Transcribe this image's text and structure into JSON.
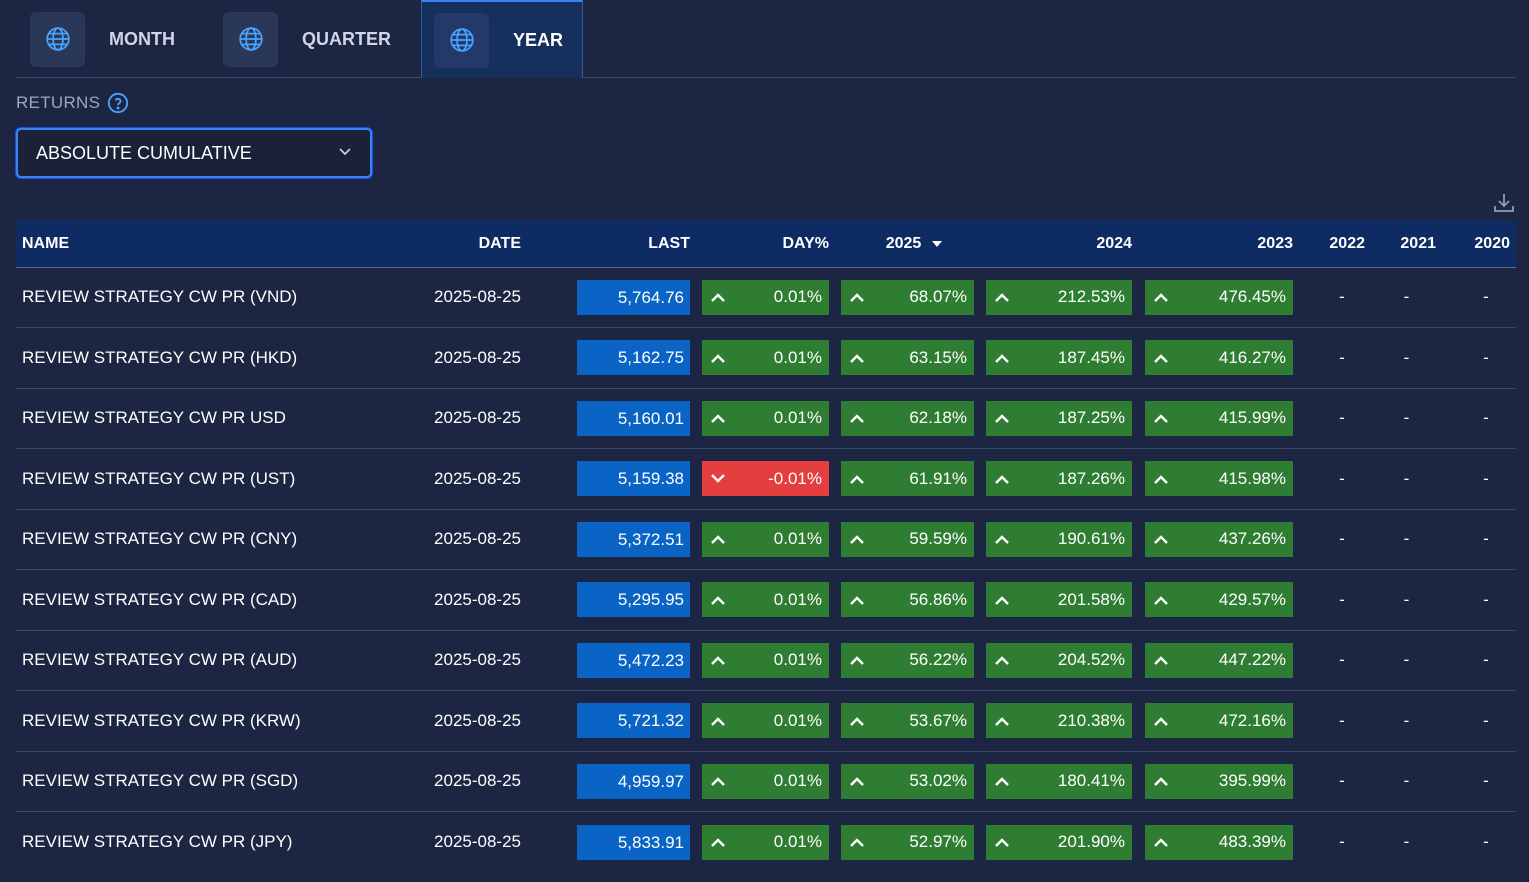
{
  "tabs": [
    {
      "label": "MONTH",
      "active": false,
      "icon": "globe-icon"
    },
    {
      "label": "QUARTER",
      "active": false,
      "icon": "globe-icon"
    },
    {
      "label": "YEAR",
      "active": true,
      "icon": "globe-icon"
    }
  ],
  "returns": {
    "label": "RETURNS",
    "help_icon": "help-circle-icon",
    "select_value": "ABSOLUTE CUMULATIVE"
  },
  "download_icon": "download-icon",
  "colors": {
    "positive": "#2e7d32",
    "negative": "#e53e3e",
    "last": "#0a64c5",
    "header": "#0f2b64",
    "background": "#1c2541"
  },
  "table": {
    "headers": {
      "name": "NAME",
      "date": "DATE",
      "last": "LAST",
      "day": "DAY%",
      "y2025": "2025",
      "y2024": "2024",
      "y2023": "2023",
      "y2022": "2022",
      "y2021": "2021",
      "y2020": "2020"
    },
    "sorted_column": "2025",
    "rows": [
      {
        "name": "REVIEW STRATEGY CW PR (VND)",
        "date": "2025-08-25",
        "last": "5,764.76",
        "day": "0.01%",
        "y2025": "68.07%",
        "y2024": "212.53%",
        "y2023": "476.45%",
        "y2022": "-",
        "y2021": "-",
        "y2020": "-"
      },
      {
        "name": "REVIEW STRATEGY CW PR (HKD)",
        "date": "2025-08-25",
        "last": "5,162.75",
        "day": "0.01%",
        "y2025": "63.15%",
        "y2024": "187.45%",
        "y2023": "416.27%",
        "y2022": "-",
        "y2021": "-",
        "y2020": "-"
      },
      {
        "name": "REVIEW STRATEGY CW PR USD",
        "date": "2025-08-25",
        "last": "5,160.01",
        "day": "0.01%",
        "y2025": "62.18%",
        "y2024": "187.25%",
        "y2023": "415.99%",
        "y2022": "-",
        "y2021": "-",
        "y2020": "-"
      },
      {
        "name": "REVIEW STRATEGY CW PR (UST)",
        "date": "2025-08-25",
        "last": "5,159.38",
        "day": "-0.01%",
        "y2025": "61.91%",
        "y2024": "187.26%",
        "y2023": "415.98%",
        "y2022": "-",
        "y2021": "-",
        "y2020": "-"
      },
      {
        "name": "REVIEW STRATEGY CW PR (CNY)",
        "date": "2025-08-25",
        "last": "5,372.51",
        "day": "0.01%",
        "y2025": "59.59%",
        "y2024": "190.61%",
        "y2023": "437.26%",
        "y2022": "-",
        "y2021": "-",
        "y2020": "-"
      },
      {
        "name": "REVIEW STRATEGY CW PR (CAD)",
        "date": "2025-08-25",
        "last": "5,295.95",
        "day": "0.01%",
        "y2025": "56.86%",
        "y2024": "201.58%",
        "y2023": "429.57%",
        "y2022": "-",
        "y2021": "-",
        "y2020": "-"
      },
      {
        "name": "REVIEW STRATEGY CW PR (AUD)",
        "date": "2025-08-25",
        "last": "5,472.23",
        "day": "0.01%",
        "y2025": "56.22%",
        "y2024": "204.52%",
        "y2023": "447.22%",
        "y2022": "-",
        "y2021": "-",
        "y2020": "-"
      },
      {
        "name": "REVIEW STRATEGY CW PR (KRW)",
        "date": "2025-08-25",
        "last": "5,721.32",
        "day": "0.01%",
        "y2025": "53.67%",
        "y2024": "210.38%",
        "y2023": "472.16%",
        "y2022": "-",
        "y2021": "-",
        "y2020": "-"
      },
      {
        "name": "REVIEW STRATEGY CW PR (SGD)",
        "date": "2025-08-25",
        "last": "4,959.97",
        "day": "0.01%",
        "y2025": "53.02%",
        "y2024": "180.41%",
        "y2023": "395.99%",
        "y2022": "-",
        "y2021": "-",
        "y2020": "-"
      },
      {
        "name": "REVIEW STRATEGY CW PR (JPY)",
        "date": "2025-08-25",
        "last": "5,833.91",
        "day": "0.01%",
        "y2025": "52.97%",
        "y2024": "201.90%",
        "y2023": "483.39%",
        "y2022": "-",
        "y2021": "-",
        "y2020": "-"
      }
    ]
  }
}
